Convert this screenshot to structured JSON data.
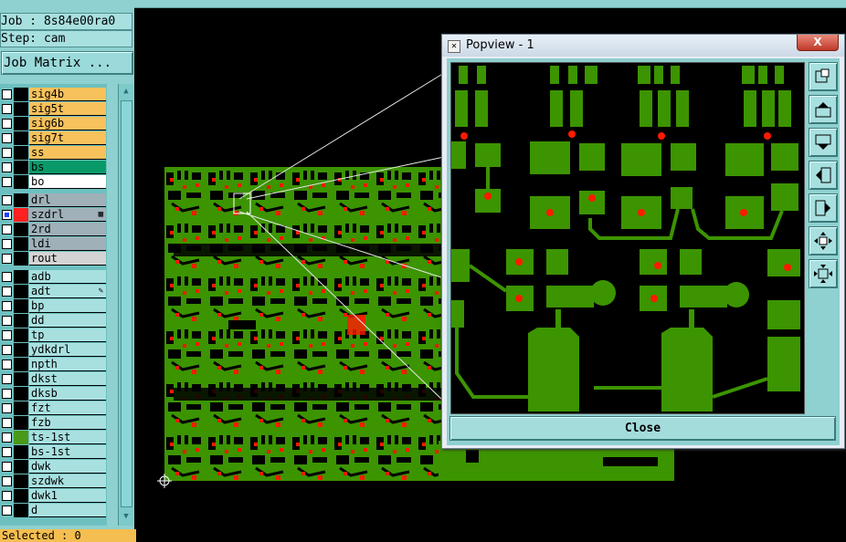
{
  "info": {
    "job": "Job : 8s84e00ra0",
    "step": "Step: cam"
  },
  "job_matrix_label": "Job Matrix ...",
  "layers": [
    {
      "name": "sig4b",
      "color": "#f7c15c",
      "checked": false
    },
    {
      "name": "sig5t",
      "color": "#f7c15c",
      "checked": false
    },
    {
      "name": "sig6b",
      "color": "#f7c15c",
      "checked": false
    },
    {
      "name": "sig7t",
      "color": "#f7c15c",
      "checked": false
    },
    {
      "name": "ss",
      "color": "#f7c15c",
      "checked": false
    },
    {
      "name": "bs",
      "color": "#0a9a6a",
      "checked": false
    },
    {
      "name": "bo",
      "color": "#ffffff",
      "checked": false
    },
    {
      "name": "drl",
      "color": "#9fb0b8",
      "checked": false
    },
    {
      "name": "szdrl",
      "color": "#9fb0b8",
      "checked": true,
      "swatch": "#ff2020",
      "icon": "grid"
    },
    {
      "name": "2rd",
      "color": "#9fb0b8",
      "checked": false
    },
    {
      "name": "ldi",
      "color": "#9fb0b8",
      "checked": false
    },
    {
      "name": "rout",
      "color": "#d4d4d4",
      "checked": false
    },
    {
      "name": "adb",
      "color": "#a8e0e0",
      "checked": false
    },
    {
      "name": "adt",
      "color": "#a8e0e0",
      "checked": false,
      "icon": "brush"
    },
    {
      "name": "bp",
      "color": "#a8e0e0",
      "checked": false
    },
    {
      "name": "dd",
      "color": "#a8e0e0",
      "checked": false
    },
    {
      "name": "tp",
      "color": "#a8e0e0",
      "checked": false
    },
    {
      "name": "ydkdrl",
      "color": "#a8e0e0",
      "checked": false
    },
    {
      "name": "npth",
      "color": "#a8e0e0",
      "checked": false
    },
    {
      "name": "dkst",
      "color": "#a8e0e0",
      "checked": false
    },
    {
      "name": "dksb",
      "color": "#a8e0e0",
      "checked": false
    },
    {
      "name": "fzt",
      "color": "#a8e0e0",
      "checked": false
    },
    {
      "name": "fzb",
      "color": "#a8e0e0",
      "checked": false
    },
    {
      "name": "ts-1st",
      "color": "#a8e0e0",
      "checked": false,
      "swatch": "#4a9a1a"
    },
    {
      "name": "bs-1st",
      "color": "#a8e0e0",
      "checked": false
    },
    {
      "name": "dwk",
      "color": "#a8e0e0",
      "checked": false
    },
    {
      "name": "szdwk",
      "color": "#a8e0e0",
      "checked": false
    },
    {
      "name": "dwk1",
      "color": "#a8e0e0",
      "checked": false
    },
    {
      "name": "d",
      "color": "#a8e0e0",
      "checked": false
    }
  ],
  "selected_label": "Selected : 0",
  "popview": {
    "title": "Popview - 1",
    "close_x": "X",
    "close_label": "Close"
  },
  "colors": {
    "copper": "#3c9400",
    "pad": "#ff1a00",
    "panel": "#8fd0d0"
  }
}
